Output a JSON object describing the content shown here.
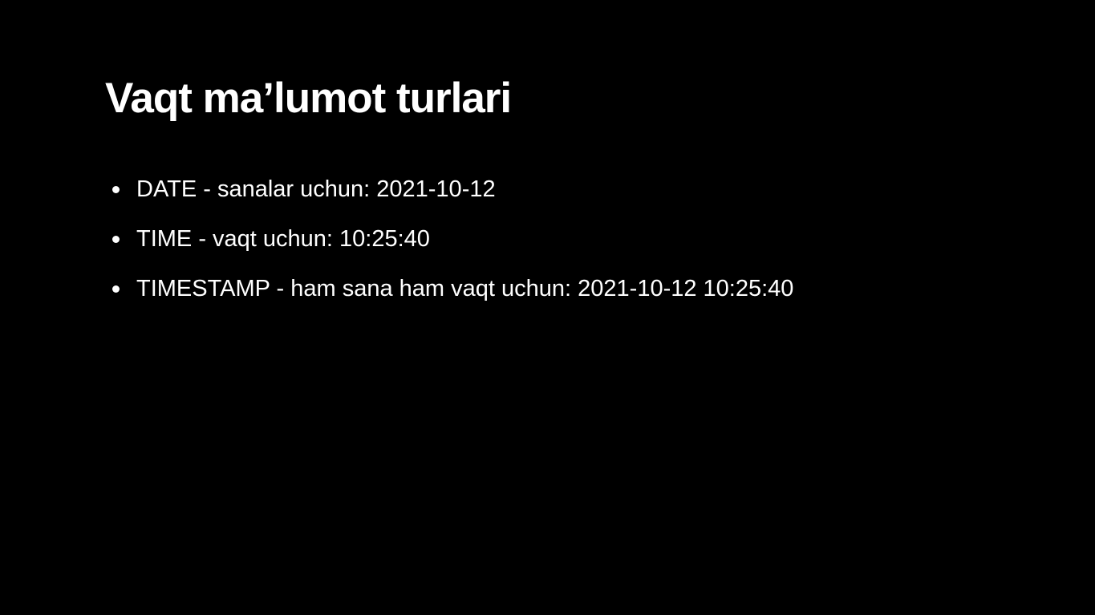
{
  "slide": {
    "title": "Vaqt ma’lumot turlari",
    "bullets": [
      "DATE - sanalar uchun: 2021-10-12",
      "TIME - vaqt uchun: 10:25:40",
      "TIMESTAMP - ham sana ham vaqt uchun: 2021-10-12 10:25:40"
    ]
  },
  "colors": {
    "background": "#000000",
    "text": "#ffffff"
  }
}
